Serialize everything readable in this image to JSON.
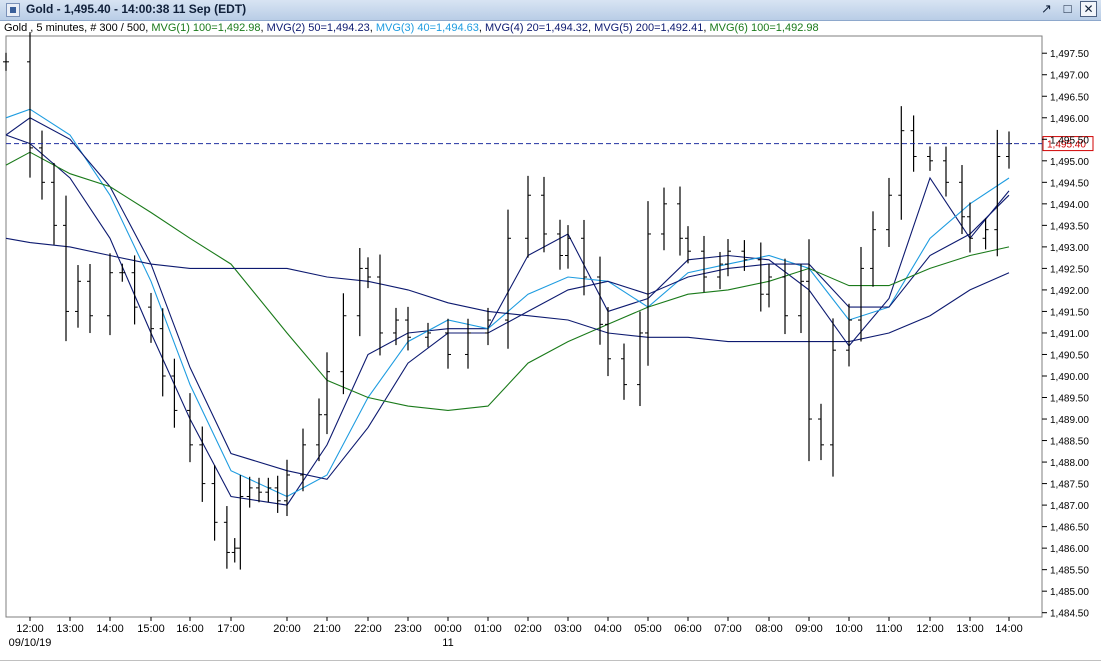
{
  "window": {
    "title": "Gold - 1,495.40 - 14:00:38  11 Sep (EDT)",
    "controls": [
      "↗",
      "□",
      "✕"
    ]
  },
  "legend": {
    "symbol_info": "Gold , 5 minutes, # 300 / 500,",
    "items": [
      {
        "label": "MVG(1) 100=1,492.98",
        "color": "#1a7a1a"
      },
      {
        "label": "MVG(2) 50=1,494.23",
        "color": "#0d1a70"
      },
      {
        "label": "MVG(3) 40=1,494.63",
        "color": "#1e9ce0"
      },
      {
        "label": "MVG(4) 20=1,494.32",
        "color": "#0d1a70"
      },
      {
        "label": "MVG(5) 200=1,492.41",
        "color": "#0d1a70"
      },
      {
        "label": "MVG(6) 100=1,492.98",
        "color": "#1a7a1a"
      }
    ]
  },
  "chart_data": {
    "type": "bar",
    "subtype": "ohlc-with-moving-averages",
    "ylim": [
      1484.4,
      1497.9
    ],
    "xlim": [
      11.35,
      14.3
    ],
    "y_ticks": [
      "1,484.50",
      "1,485.00",
      "1,485.50",
      "1,486.00",
      "1,486.50",
      "1,487.00",
      "1,487.50",
      "1,488.00",
      "1,488.50",
      "1,489.00",
      "1,489.50",
      "1,490.00",
      "1,490.50",
      "1,491.00",
      "1,491.50",
      "1,492.00",
      "1,492.50",
      "1,493.00",
      "1,493.50",
      "1,494.00",
      "1,494.50",
      "1,495.00",
      "1,495.50",
      "1,496.00",
      "1,496.50",
      "1,497.00",
      "1,497.50"
    ],
    "y_tick_values": [
      1484.5,
      1485,
      1485.5,
      1486,
      1486.5,
      1487,
      1487.5,
      1488,
      1488.5,
      1489,
      1489.5,
      1490,
      1490.5,
      1491,
      1491.5,
      1492,
      1492.5,
      1493,
      1493.5,
      1494,
      1494.5,
      1495,
      1495.5,
      1496,
      1496.5,
      1497,
      1497.5
    ],
    "x_ticks": [
      "12:00",
      "13:00",
      "14:00",
      "15:00",
      "16:00",
      "17:00",
      "20:00",
      "21:00",
      "22:00",
      "23:00",
      "00:00",
      "01:00",
      "02:00",
      "03:00",
      "04:00",
      "05:00",
      "06:00",
      "07:00",
      "08:00",
      "09:00",
      "10:00",
      "11:00",
      "12:00",
      "13:00",
      "14:00"
    ],
    "x_tick_values": [
      12,
      13,
      14,
      15,
      16,
      17,
      20,
      21,
      22,
      23,
      24,
      25,
      26,
      27,
      28,
      29,
      30,
      31,
      32,
      33,
      34,
      35,
      36,
      37,
      38
    ],
    "date_labels": [
      {
        "label": "09/10/19",
        "x": 12
      },
      {
        "label": "11",
        "x": 24
      }
    ],
    "last_price": {
      "label": "1,495.40",
      "value": 1495.4
    },
    "gridlines": false,
    "series": [
      {
        "name": "MVG(4) 20",
        "color": "#0d1a70",
        "points": [
          [
            11.4,
            1495.6
          ],
          [
            12,
            1495.4
          ],
          [
            13,
            1494.6
          ],
          [
            14,
            1493.2
          ],
          [
            15,
            1491.0
          ],
          [
            16,
            1489.0
          ],
          [
            17,
            1487.2
          ],
          [
            20,
            1487.0
          ],
          [
            21,
            1488.4
          ],
          [
            22,
            1490.5
          ],
          [
            23,
            1491.0
          ],
          [
            24,
            1491.1
          ],
          [
            25,
            1491.1
          ],
          [
            26,
            1492.8
          ],
          [
            27,
            1493.3
          ],
          [
            28,
            1491.5
          ],
          [
            29,
            1491.8
          ],
          [
            30,
            1492.7
          ],
          [
            31,
            1492.8
          ],
          [
            32,
            1492.7
          ],
          [
            33,
            1492.0
          ],
          [
            34,
            1490.7
          ],
          [
            35,
            1491.8
          ],
          [
            36,
            1494.6
          ],
          [
            37,
            1493.2
          ],
          [
            38,
            1494.3
          ]
        ]
      },
      {
        "name": "MVG(3) 40",
        "color": "#1e9ce0",
        "points": [
          [
            11.4,
            1496.0
          ],
          [
            12,
            1496.2
          ],
          [
            13,
            1495.6
          ],
          [
            14,
            1494.2
          ],
          [
            15,
            1492.2
          ],
          [
            16,
            1489.8
          ],
          [
            17,
            1487.8
          ],
          [
            20,
            1487.2
          ],
          [
            21,
            1487.7
          ],
          [
            22,
            1489.5
          ],
          [
            23,
            1490.8
          ],
          [
            24,
            1491.3
          ],
          [
            25,
            1491.1
          ],
          [
            26,
            1491.9
          ],
          [
            27,
            1492.3
          ],
          [
            28,
            1492.2
          ],
          [
            29,
            1491.6
          ],
          [
            30,
            1492.4
          ],
          [
            31,
            1492.6
          ],
          [
            32,
            1492.8
          ],
          [
            33,
            1492.5
          ],
          [
            34,
            1491.3
          ],
          [
            35,
            1491.6
          ],
          [
            36,
            1493.2
          ],
          [
            37,
            1494.0
          ],
          [
            38,
            1494.6
          ]
        ]
      },
      {
        "name": "MVG(2) 50",
        "color": "#0d1a70",
        "points": [
          [
            11.4,
            1495.6
          ],
          [
            12,
            1496.0
          ],
          [
            13,
            1495.5
          ],
          [
            14,
            1494.4
          ],
          [
            15,
            1492.6
          ],
          [
            16,
            1490.2
          ],
          [
            17,
            1488.2
          ],
          [
            20,
            1487.8
          ],
          [
            21,
            1487.6
          ],
          [
            22,
            1488.8
          ],
          [
            23,
            1490.3
          ],
          [
            24,
            1491.0
          ],
          [
            25,
            1491.0
          ],
          [
            26,
            1491.5
          ],
          [
            27,
            1492.0
          ],
          [
            28,
            1492.2
          ],
          [
            29,
            1491.9
          ],
          [
            30,
            1492.3
          ],
          [
            31,
            1492.5
          ],
          [
            32,
            1492.6
          ],
          [
            33,
            1492.6
          ],
          [
            34,
            1491.6
          ],
          [
            35,
            1491.6
          ],
          [
            36,
            1492.8
          ],
          [
            37,
            1493.3
          ],
          [
            38,
            1494.2
          ]
        ]
      },
      {
        "name": "MVG(1) 100",
        "color": "#1a7a1a",
        "points": [
          [
            11.4,
            1494.9
          ],
          [
            12,
            1495.2
          ],
          [
            13,
            1494.7
          ],
          [
            14,
            1494.4
          ],
          [
            15,
            1493.8
          ],
          [
            16,
            1493.2
          ],
          [
            17,
            1492.6
          ],
          [
            20,
            1491.0
          ],
          [
            21,
            1489.9
          ],
          [
            22,
            1489.5
          ],
          [
            23,
            1489.3
          ],
          [
            24,
            1489.2
          ],
          [
            25,
            1489.3
          ],
          [
            26,
            1490.3
          ],
          [
            27,
            1490.8
          ],
          [
            28,
            1491.2
          ],
          [
            29,
            1491.6
          ],
          [
            30,
            1491.9
          ],
          [
            31,
            1492.0
          ],
          [
            32,
            1492.2
          ],
          [
            33,
            1492.5
          ],
          [
            34,
            1492.1
          ],
          [
            35,
            1492.1
          ],
          [
            36,
            1492.5
          ],
          [
            37,
            1492.8
          ],
          [
            38,
            1493.0
          ]
        ]
      },
      {
        "name": "MVG(5) 200",
        "color": "#0d1a70",
        "points": [
          [
            11.4,
            1493.2
          ],
          [
            12,
            1493.1
          ],
          [
            13,
            1493.0
          ],
          [
            14,
            1492.8
          ],
          [
            15,
            1492.6
          ],
          [
            16,
            1492.5
          ],
          [
            17,
            1492.5
          ],
          [
            20,
            1492.5
          ],
          [
            21,
            1492.3
          ],
          [
            22,
            1492.2
          ],
          [
            23,
            1492.0
          ],
          [
            24,
            1491.7
          ],
          [
            25,
            1491.5
          ],
          [
            26,
            1491.4
          ],
          [
            27,
            1491.3
          ],
          [
            28,
            1491.0
          ],
          [
            29,
            1490.9
          ],
          [
            30,
            1490.9
          ],
          [
            31,
            1490.8
          ],
          [
            32,
            1490.8
          ],
          [
            33,
            1490.8
          ],
          [
            34,
            1490.8
          ],
          [
            35,
            1491.0
          ],
          [
            36,
            1491.4
          ],
          [
            37,
            1492.0
          ],
          [
            38,
            1492.4
          ]
        ]
      }
    ],
    "price_bars": {
      "color": "#000000",
      "points": [
        [
          11.4,
          1497.3
        ],
        [
          12,
          1495.3
        ],
        [
          12.3,
          1494.5
        ],
        [
          12.6,
          1493.5
        ],
        [
          12.9,
          1491.5
        ],
        [
          13.2,
          1492.2
        ],
        [
          13.5,
          1491.4
        ],
        [
          14,
          1492.4
        ],
        [
          14.3,
          1492.4
        ],
        [
          14.6,
          1491.6
        ],
        [
          15,
          1491.1
        ],
        [
          15.3,
          1490.0
        ],
        [
          15.6,
          1489.2
        ],
        [
          16,
          1488.4
        ],
        [
          16.3,
          1487.5
        ],
        [
          16.6,
          1486.6
        ],
        [
          16.9,
          1485.9
        ],
        [
          17.2,
          1486.0
        ],
        [
          17.5,
          1487.2
        ],
        [
          18,
          1487.4
        ],
        [
          18.5,
          1487.3
        ],
        [
          19,
          1487.4
        ],
        [
          19.5,
          1487.1
        ],
        [
          20,
          1487.7
        ],
        [
          20.4,
          1488.4
        ],
        [
          20.8,
          1489.1
        ],
        [
          21,
          1490.1
        ],
        [
          21.4,
          1491.4
        ],
        [
          21.8,
          1492.5
        ],
        [
          22,
          1492.3
        ],
        [
          22.3,
          1491.0
        ],
        [
          22.7,
          1491.3
        ],
        [
          23,
          1490.9
        ],
        [
          23.5,
          1491.0
        ],
        [
          24,
          1490.5
        ],
        [
          24.5,
          1491.0
        ],
        [
          25,
          1491.3
        ],
        [
          25.5,
          1493.2
        ],
        [
          26,
          1494.2
        ],
        [
          26.4,
          1493.3
        ],
        [
          26.8,
          1492.8
        ],
        [
          27,
          1493.2
        ],
        [
          27.4,
          1492.3
        ],
        [
          27.8,
          1491.2
        ],
        [
          28,
          1490.4
        ],
        [
          28.4,
          1489.8
        ],
        [
          28.8,
          1491.0
        ],
        [
          29,
          1493.3
        ],
        [
          29.4,
          1494.0
        ],
        [
          29.8,
          1493.2
        ],
        [
          30,
          1492.9
        ],
        [
          30.4,
          1492.3
        ],
        [
          30.8,
          1492.6
        ],
        [
          31,
          1492.9
        ],
        [
          31.4,
          1492.7
        ],
        [
          31.8,
          1491.9
        ],
        [
          32,
          1492.3
        ],
        [
          32.4,
          1491.4
        ],
        [
          32.8,
          1492.2
        ],
        [
          33,
          1489.0
        ],
        [
          33.3,
          1488.4
        ],
        [
          33.6,
          1490.6
        ],
        [
          34,
          1491.3
        ],
        [
          34.3,
          1492.5
        ],
        [
          34.6,
          1493.4
        ],
        [
          35,
          1494.2
        ],
        [
          35.3,
          1495.7
        ],
        [
          35.6,
          1495.1
        ],
        [
          36,
          1495.0
        ],
        [
          36.4,
          1494.5
        ],
        [
          36.8,
          1493.7
        ],
        [
          37,
          1493.2
        ],
        [
          37.4,
          1493.4
        ],
        [
          37.7,
          1495.1
        ],
        [
          38,
          1495.4
        ]
      ]
    }
  }
}
